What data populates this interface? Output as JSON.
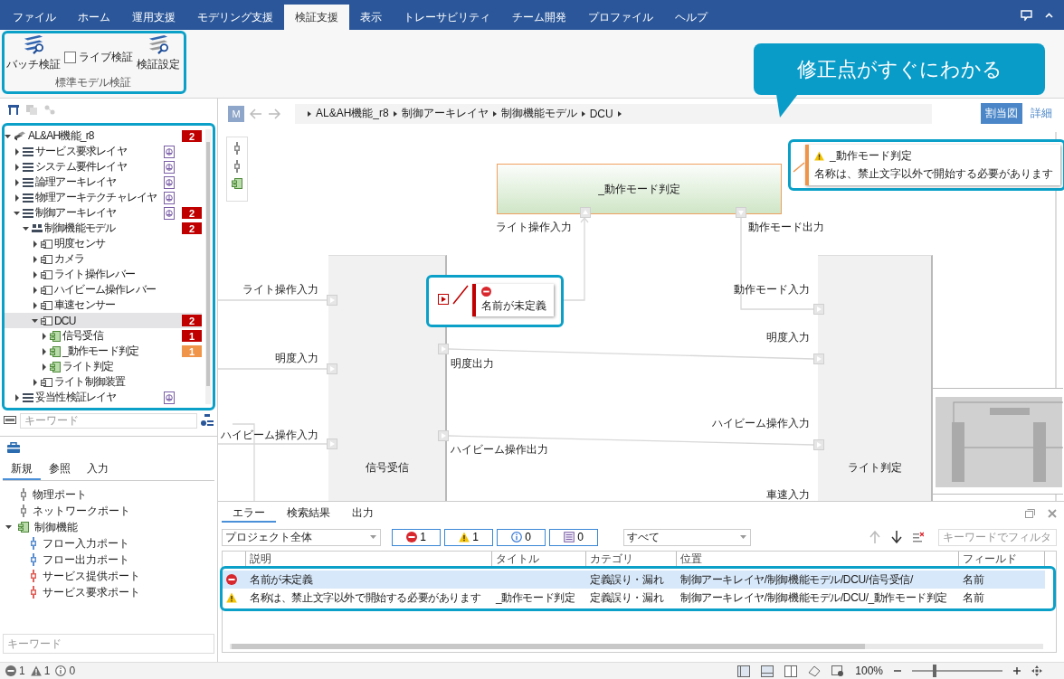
{
  "menu_tabs": [
    {
      "label": "ファイル",
      "selected": false
    },
    {
      "label": "ホーム",
      "selected": false
    },
    {
      "label": "運用支援",
      "selected": false
    },
    {
      "label": "モデリング支援",
      "selected": false
    },
    {
      "label": "検証支援",
      "selected": true
    },
    {
      "label": "表示",
      "selected": false
    },
    {
      "label": "トレーサビリティ",
      "selected": false
    },
    {
      "label": "チーム開発",
      "selected": false
    },
    {
      "label": "プロファイル",
      "selected": false
    },
    {
      "label": "ヘルプ",
      "selected": false
    }
  ],
  "ribbon": {
    "batch_label": "バッチ検証",
    "live_check": {
      "label": "ライブ検証",
      "checked": false
    },
    "settings_label": "検証設定",
    "group_label": "標準モデル検証"
  },
  "callout": {
    "text": "修正点がすぐにわかる"
  },
  "left_panel": {
    "tree": [
      {
        "label": "AL&AH機能_r8",
        "kind": "root",
        "expanded": true,
        "selected": false,
        "diagram": false,
        "badge": {
          "text": "2",
          "color": "#c00000"
        },
        "children": [
          {
            "label": "サービス要求レイヤ",
            "kind": "layer",
            "expanded": false,
            "selected": false,
            "diagram": true
          },
          {
            "label": "システム要件レイヤ",
            "kind": "layer",
            "expanded": false,
            "selected": false,
            "diagram": true
          },
          {
            "label": "論理アーキレイヤ",
            "kind": "layer",
            "expanded": false,
            "selected": false,
            "diagram": true
          },
          {
            "label": "物理アーキテクチャレイヤ",
            "kind": "layer",
            "expanded": false,
            "selected": false,
            "diagram": true
          },
          {
            "label": "制御アーキレイヤ",
            "kind": "layer",
            "expanded": true,
            "selected": false,
            "diagram": true,
            "badge": {
              "text": "2",
              "color": "#c00000"
            },
            "children": [
              {
                "label": "制御機能モデル",
                "kind": "model",
                "expanded": true,
                "selected": false,
                "diagram": false,
                "badge": {
                  "text": "2",
                  "color": "#c00000"
                },
                "children": [
                  {
                    "label": "明度センサ",
                    "kind": "component",
                    "expanded": false,
                    "selected": false,
                    "diagram": false
                  },
                  {
                    "label": "カメラ",
                    "kind": "component",
                    "expanded": false,
                    "selected": false,
                    "diagram": false
                  },
                  {
                    "label": "ライト操作レバー",
                    "kind": "component",
                    "expanded": false,
                    "selected": false,
                    "diagram": false
                  },
                  {
                    "label": "ハイビーム操作レバー",
                    "kind": "component",
                    "expanded": false,
                    "selected": false,
                    "diagram": false
                  },
                  {
                    "label": "車速センサー",
                    "kind": "component",
                    "expanded": false,
                    "selected": false,
                    "diagram": false
                  },
                  {
                    "label": "DCU",
                    "kind": "component",
                    "expanded": true,
                    "selected": true,
                    "diagram": false,
                    "badge": {
                      "text": "2",
                      "color": "#c00000"
                    },
                    "children": [
                      {
                        "label": "信号受信",
                        "kind": "function",
                        "expanded": false,
                        "selected": false,
                        "diagram": false,
                        "badge": {
                          "text": "1",
                          "color": "#c00000"
                        }
                      },
                      {
                        "label": "_動作モード判定",
                        "kind": "function",
                        "expanded": false,
                        "selected": false,
                        "diagram": false,
                        "badge": {
                          "text": "1",
                          "color": "#f0944a"
                        }
                      },
                      {
                        "label": "ライト判定",
                        "kind": "function",
                        "expanded": false,
                        "selected": false,
                        "diagram": false
                      }
                    ]
                  },
                  {
                    "label": "ライト制御装置",
                    "kind": "component",
                    "expanded": false,
                    "selected": false,
                    "diagram": false
                  }
                ]
              }
            ]
          },
          {
            "label": "妥当性検証レイヤ",
            "kind": "layer",
            "expanded": false,
            "selected": false,
            "diagram": true
          }
        ]
      }
    ],
    "keyword_placeholder": "キーワード",
    "palette_tabs": [
      {
        "label": "新規",
        "selected": true
      },
      {
        "label": "参照",
        "selected": false
      },
      {
        "label": "入力",
        "selected": false
      }
    ],
    "palette_items": [
      {
        "label": "物理ポート",
        "kind": "port",
        "color": "#8c8c8c"
      },
      {
        "label": "ネットワークポート",
        "kind": "port",
        "color": "#8c8c8c"
      },
      {
        "label": "制御機能",
        "kind": "function",
        "expanded": true,
        "children": [
          {
            "label": "フロー入力ポート",
            "kind": "port",
            "color": "#5b8fd0"
          },
          {
            "label": "フロー出力ポート",
            "kind": "port",
            "color": "#5b8fd0"
          },
          {
            "label": "サービス提供ポート",
            "kind": "port",
            "color": "#e0605a"
          },
          {
            "label": "サービス要求ポート",
            "kind": "port",
            "color": "#e0605a"
          }
        ]
      }
    ],
    "palette_keyword_placeholder": "キーワード"
  },
  "editor": {
    "model_button": "M",
    "breadcrumb": [
      "AL&AH機能_r8",
      "制御アーキレイヤ",
      "制御機能モデル",
      "DCU"
    ],
    "view_buttons": [
      {
        "label": "割当図",
        "selected": true
      },
      {
        "label": "詳細",
        "selected": false
      }
    ],
    "diagram": {
      "nodes": [
        {
          "label": "_動作モード判定",
          "kind": "function"
        },
        {
          "label": "信号受信",
          "kind": "block"
        },
        {
          "label": "ライト判定",
          "kind": "block"
        }
      ],
      "port_labels": [
        "ライト操作入力",
        "動作モード出力",
        "ライト操作入力",
        "明度入力",
        "ハイビーム操作入力",
        "明度出力",
        "ハイビーム操作出力",
        "動作モード入力",
        "明度入力",
        "ハイビーム操作入力",
        "車速入力"
      ],
      "error_marker": {
        "text": "名前が未定義"
      },
      "warning_marker": {
        "title": "_動作モード判定",
        "text": "名称は、禁止文字以外で開始する必要があります"
      }
    }
  },
  "error_panel": {
    "tabs": [
      {
        "label": "エラー",
        "selected": true
      },
      {
        "label": "検索結果",
        "selected": false
      },
      {
        "label": "出力",
        "selected": false
      }
    ],
    "scope": "プロジェクト全体",
    "filters": [
      {
        "kind": "error",
        "count": "1"
      },
      {
        "kind": "warning",
        "count": "1"
      },
      {
        "kind": "info",
        "count": "0"
      },
      {
        "kind": "message",
        "count": "0"
      }
    ],
    "category": "すべて",
    "filter_placeholder": "キーワードでフィルタ",
    "columns": [
      "説明",
      "タイトル",
      "カテゴリ",
      "位置",
      "フィールド"
    ],
    "rows": [
      {
        "kind": "error",
        "selected": true,
        "description": "名前が未定義",
        "category": "定義誤り・漏れ",
        "location": "制御アーキレイヤ/制御機能モデル/DCU/信号受信/",
        "field": "名前"
      },
      {
        "kind": "warning",
        "selected": false,
        "description": "名称は、禁止文字以外で開始する必要があります",
        "title": "_動作モード判定",
        "category": "定義誤り・漏れ",
        "location": "制御アーキレイヤ/制御機能モデル/DCU/_動作モード判定",
        "field": "名前"
      }
    ]
  },
  "status_bar": {
    "counts": [
      {
        "kind": "error",
        "count": "1"
      },
      {
        "kind": "warning",
        "count": "1"
      },
      {
        "kind": "info",
        "count": "0"
      }
    ],
    "zoom": {
      "text": "100%",
      "level": 0.25
    }
  }
}
